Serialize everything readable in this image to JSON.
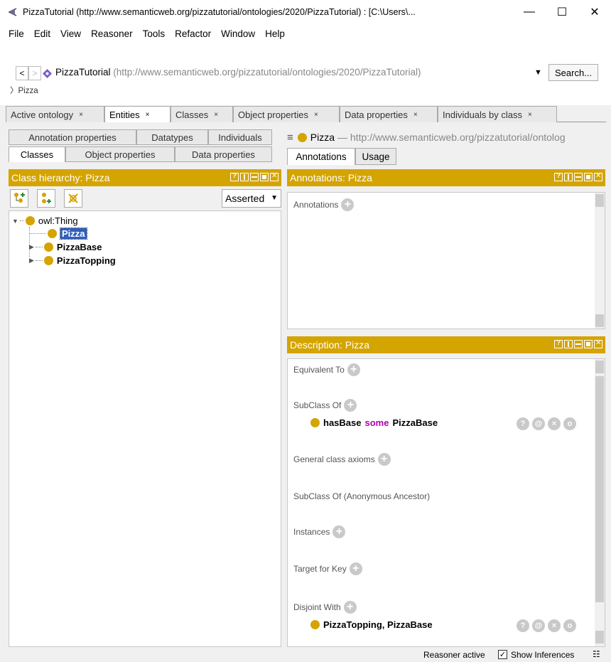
{
  "window": {
    "title": "PizzaTutorial (http://www.semanticweb.org/pizzatutorial/ontologies/2020/PizzaTutorial) : [C:\\Users\\...",
    "minimize": "—",
    "maximize": "☐",
    "close": "✕"
  },
  "menu": [
    "File",
    "Edit",
    "View",
    "Reasoner",
    "Tools",
    "Refactor",
    "Window",
    "Help"
  ],
  "nav": {
    "back": "<",
    "forward": ">",
    "ontology_name": "PizzaTutorial",
    "ontology_uri": "(http://www.semanticweb.org/pizzatutorial/ontologies/2020/PizzaTutorial)",
    "search_label": "Search...",
    "breadcrumb": "Pizza"
  },
  "tabs": [
    {
      "label": "Active ontology",
      "close": "×"
    },
    {
      "label": "Entities",
      "close": "×"
    },
    {
      "label": "Classes",
      "close": "×"
    },
    {
      "label": "Object properties",
      "close": "×"
    },
    {
      "label": "Data properties",
      "close": "×"
    },
    {
      "label": "Individuals by class",
      "close": "×"
    }
  ],
  "left": {
    "subtabs_row1": [
      "Annotation properties",
      "Datatypes",
      "Individuals"
    ],
    "subtabs_row2": [
      "Classes",
      "Object properties",
      "Data properties"
    ],
    "header": "Class hierarchy: Pizza",
    "asserted": "Asserted",
    "tree": {
      "root": "owl:Thing",
      "children": [
        "Pizza",
        "PizzaBase",
        "PizzaTopping"
      ]
    }
  },
  "right": {
    "entity_name": "Pizza",
    "entity_uri": "— http://www.semanticweb.org/pizzatutorial/ontolog",
    "tabs": [
      "Annotations",
      "Usage"
    ],
    "annotations_header": "Annotations: Pizza",
    "annotations_label": "Annotations",
    "description_header": "Description: Pizza",
    "sections": {
      "equivalent_to": "Equivalent To",
      "subclass_of": "SubClass Of",
      "general_axioms": "General class axioms",
      "subclass_anon": "SubClass Of (Anonymous Ancestor)",
      "instances": "Instances",
      "target_for_key": "Target for Key",
      "disjoint_with": "Disjoint With"
    },
    "subclass_axiom": {
      "prop": "hasBase",
      "kw": "some",
      "cls": "PizzaBase"
    },
    "disjoint_axiom": "PizzaTopping, PizzaBase",
    "axiom_buttons": [
      "?",
      "@",
      "×",
      "o"
    ]
  },
  "status": {
    "reasoner": "Reasoner active",
    "show_inferences": "Show Inferences",
    "checked": "✓"
  },
  "colors": {
    "accent": "#d4a400",
    "keyword": "#b000b0",
    "selection": "#2e5fc0"
  }
}
